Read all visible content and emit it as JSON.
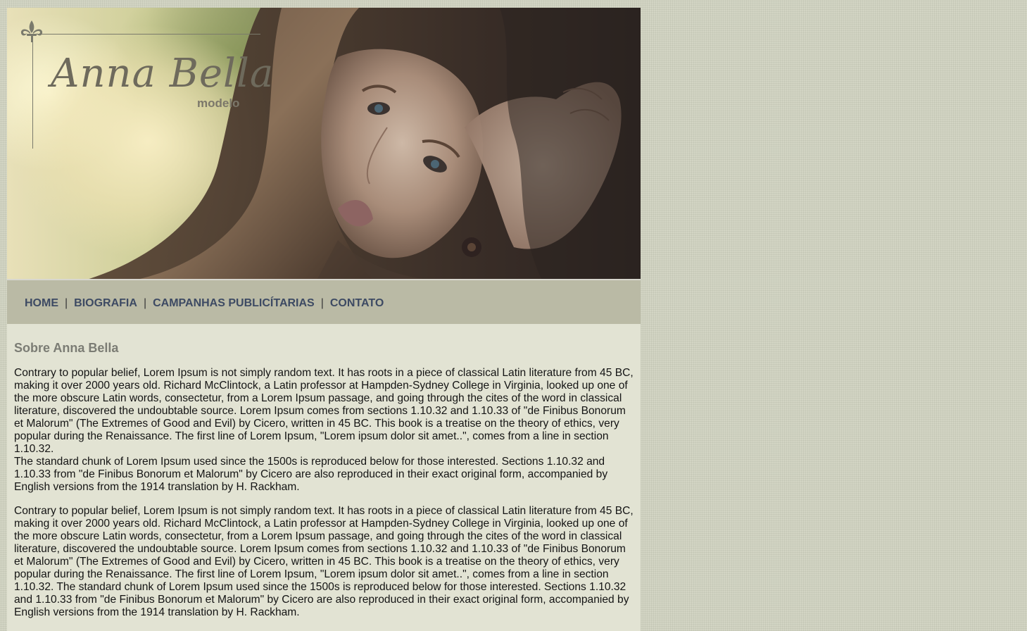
{
  "header": {
    "logo_name": "Anna Bella",
    "logo_subtitle": "modelo"
  },
  "nav": {
    "items": [
      {
        "label": "HOME"
      },
      {
        "label": "BIOGRAFIA"
      },
      {
        "label": "CAMPANHAS PUBLICÍTARIAS"
      },
      {
        "label": "CONTATO"
      }
    ],
    "separator": "|"
  },
  "content": {
    "title": "Sobre Anna Bella",
    "paragraphs": [
      {
        "line1": "Contrary to popular belief, Lorem Ipsum is not simply random text. It has roots in a piece of classical Latin literature from 45 BC, making it over 2000 years old. Richard McClintock, a Latin professor at Hampden-Sydney College in Virginia, looked up one of the more obscure Latin words, consectetur, from a Lorem Ipsum passage, and going through the cites of the word in classical literature, discovered the undoubtable source. Lorem Ipsum comes from sections 1.10.32 and 1.10.33 of \"de Finibus Bonorum et Malorum\" (The Extremes of Good and Evil) by Cicero, written in 45 BC. This book is a treatise on the theory of ethics, very popular during the Renaissance. The first line of Lorem Ipsum, \"Lorem ipsum dolor sit amet..\", comes from a line in section 1.10.32.",
        "line2": "The standard chunk of Lorem Ipsum used since the 1500s is reproduced below for those interested. Sections 1.10.32 and 1.10.33 from \"de Finibus Bonorum et Malorum\" by Cicero are also reproduced in their exact original form, accompanied by English versions from the 1914 translation by H. Rackham."
      },
      {
        "text": "Contrary to popular belief, Lorem Ipsum is not simply random text. It has roots in a piece of classical Latin literature from 45 BC, making it over 2000 years old. Richard McClintock, a Latin professor at Hampden-Sydney College in Virginia, looked up one of the more obscure Latin words, consectetur, from a Lorem Ipsum passage, and going through the cites of the word in classical literature, discovered the undoubtable source. Lorem Ipsum comes from sections 1.10.32 and 1.10.33 of \"de Finibus Bonorum et Malorum\" (The Extremes of Good and Evil) by Cicero, written in 45 BC. This book is a treatise on the theory of ethics, very popular during the Renaissance. The first line of Lorem Ipsum, \"Lorem ipsum dolor sit amet..\", comes from a line in section 1.10.32. The standard chunk of Lorem Ipsum used since the 1500s is reproduced below for those interested. Sections 1.10.32 and 1.10.33 from \"de Finibus Bonorum et Malorum\" by Cicero are also reproduced in their exact original form, accompanied by English versions from the 1914 translation by H. Rackham."
      }
    ]
  },
  "icons": {
    "logo_ornament": "fleur-de-lis-icon"
  },
  "colors": {
    "nav_background": "#babaa5",
    "nav_text": "#3d4a63",
    "content_background": "#e2e3d3",
    "title_text": "#7b7c74",
    "page_background": "#d3d5c4"
  }
}
